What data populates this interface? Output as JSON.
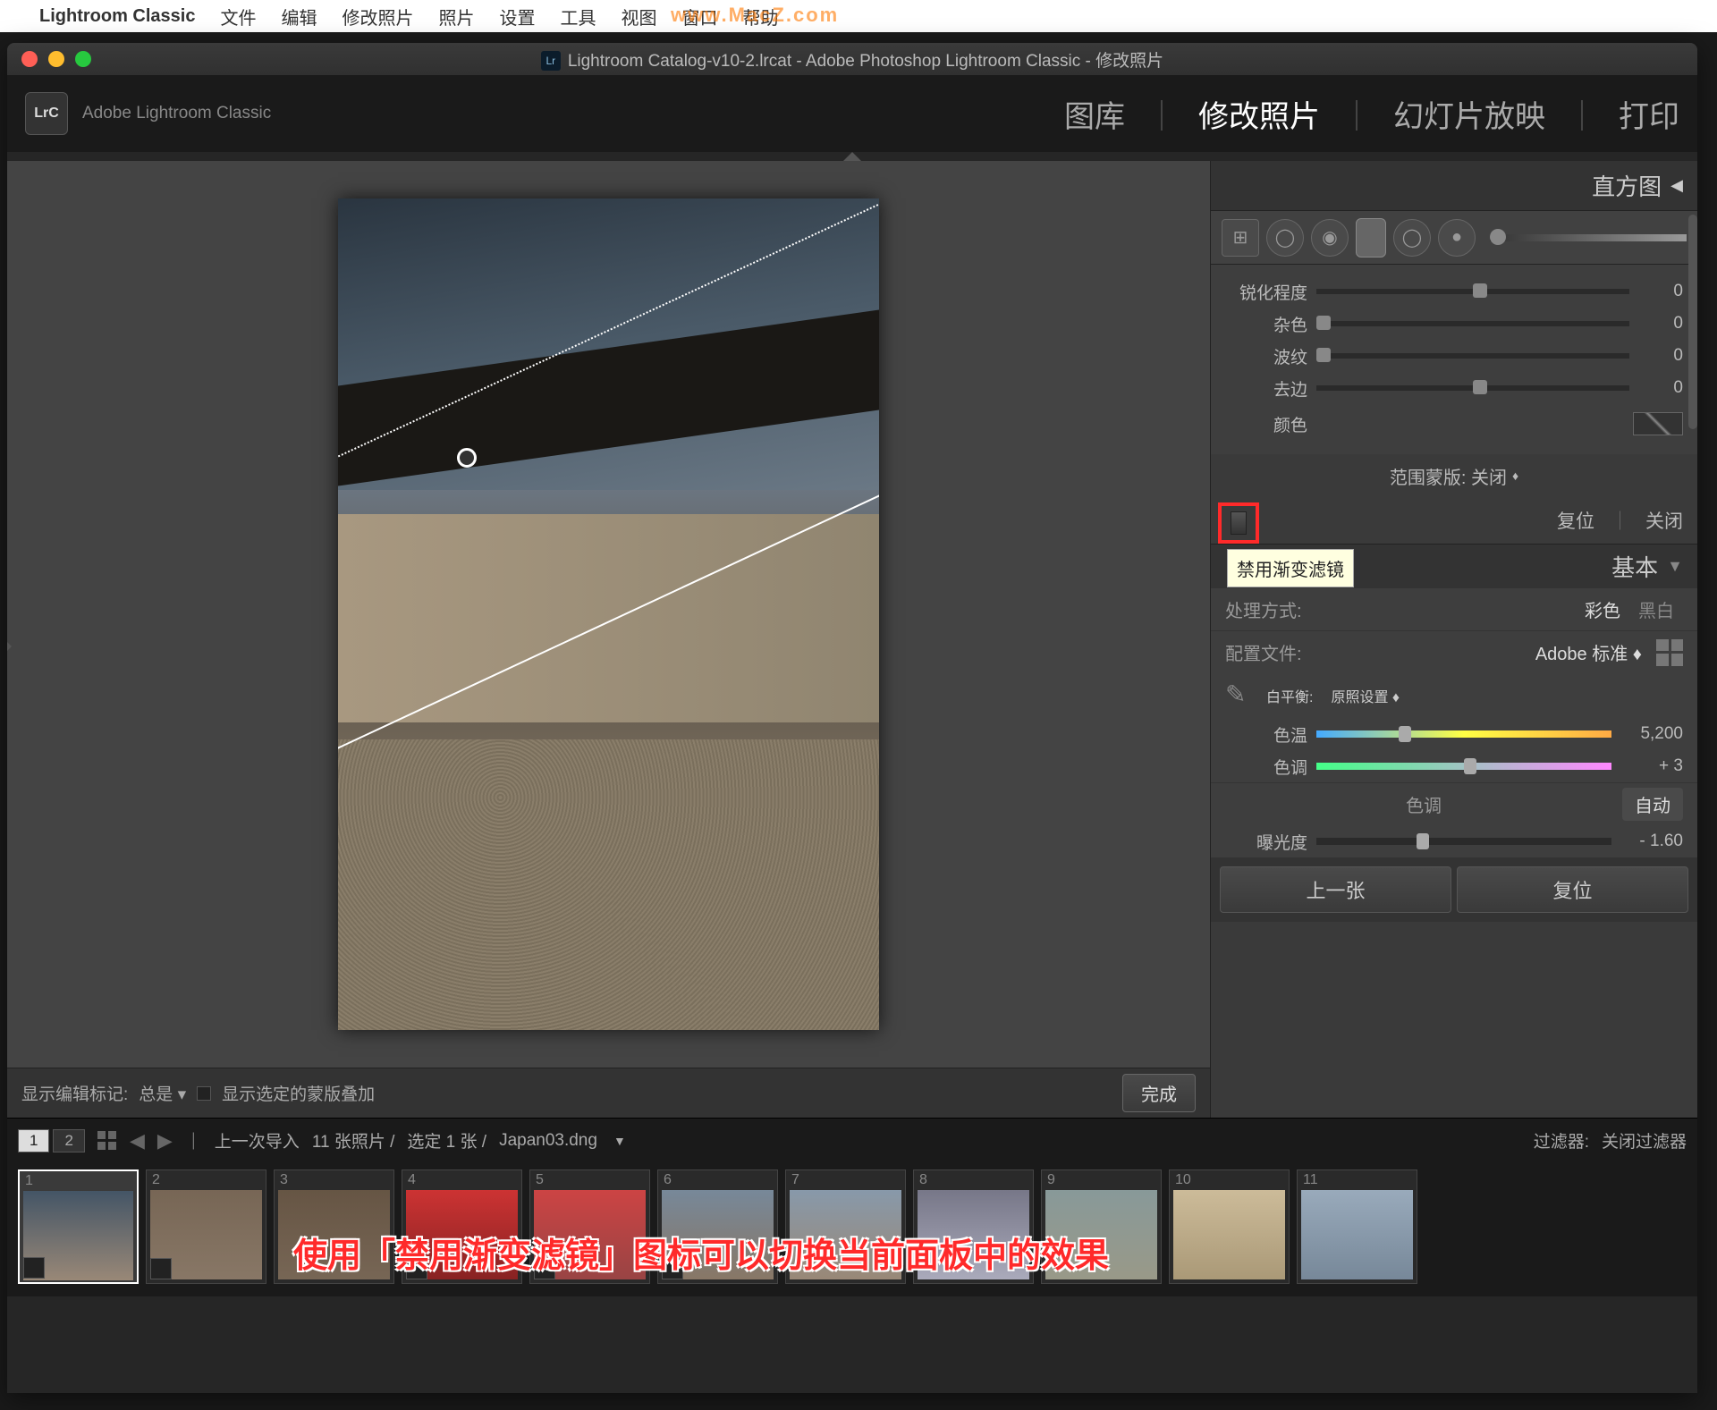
{
  "mac_menu": {
    "apple": "",
    "app": "Lightroom Classic",
    "items": [
      "文件",
      "编辑",
      "修改照片",
      "照片",
      "设置",
      "工具",
      "视图",
      "窗口",
      "帮助"
    ]
  },
  "watermark": "www.MacZ.com",
  "window_title": "Lightroom Catalog-v10-2.lrcat - Adobe Photoshop Lightroom Classic - 修改照片",
  "logo_text": "LrC",
  "brand": "Adobe Lightroom Classic",
  "modules": {
    "library": "图库",
    "develop": "修改照片",
    "slideshow": "幻灯片放映",
    "print": "打印"
  },
  "histogram": "直方图",
  "sliders": {
    "sharpness": {
      "label": "锐化程度",
      "value": "0"
    },
    "noise": {
      "label": "杂色",
      "value": "0"
    },
    "moire": {
      "label": "波纹",
      "value": "0"
    },
    "defringe": {
      "label": "去边",
      "value": "0"
    },
    "color": {
      "label": "颜色"
    }
  },
  "range_mask": {
    "label": "范围蒙版:",
    "value": "关闭"
  },
  "actions": {
    "reset": "复位",
    "close": "关闭"
  },
  "tooltip": "禁用渐变滤镜",
  "basic": {
    "title": "基本",
    "treatment": {
      "label": "处理方式:",
      "color": "彩色",
      "bw": "黑白"
    },
    "profile": {
      "label": "配置文件:",
      "value": "Adobe 标准"
    },
    "wb": {
      "label": "白平衡:",
      "value": "原照设置"
    },
    "temp": {
      "label": "色温",
      "value": "5,200"
    },
    "tint": {
      "label": "色调",
      "value": "+ 3"
    },
    "tone": {
      "label": "色调",
      "auto": "自动"
    },
    "exposure": {
      "label": "曝光度",
      "value": "- 1.60"
    }
  },
  "nav": {
    "prev": "上一张",
    "reset": "复位"
  },
  "canvas_bar": {
    "show_edit": "显示编辑标记:",
    "always": "总是",
    "show_mask": "显示选定的蒙版叠加",
    "done": "完成"
  },
  "film_bar": {
    "s1": "1",
    "s2": "2",
    "last_import": "上一次导入",
    "count": "11 张照片 /",
    "selected": "选定 1 张 /",
    "filename": "Japan03.dng",
    "filter_label": "过滤器:",
    "filter_value": "关闭过滤器"
  },
  "thumbs": [
    "1",
    "2",
    "3",
    "4",
    "5",
    "6",
    "7",
    "8",
    "9",
    "10",
    "11"
  ],
  "annotation": "使用「禁用渐变滤镜」图标可以切换当前面板中的效果"
}
